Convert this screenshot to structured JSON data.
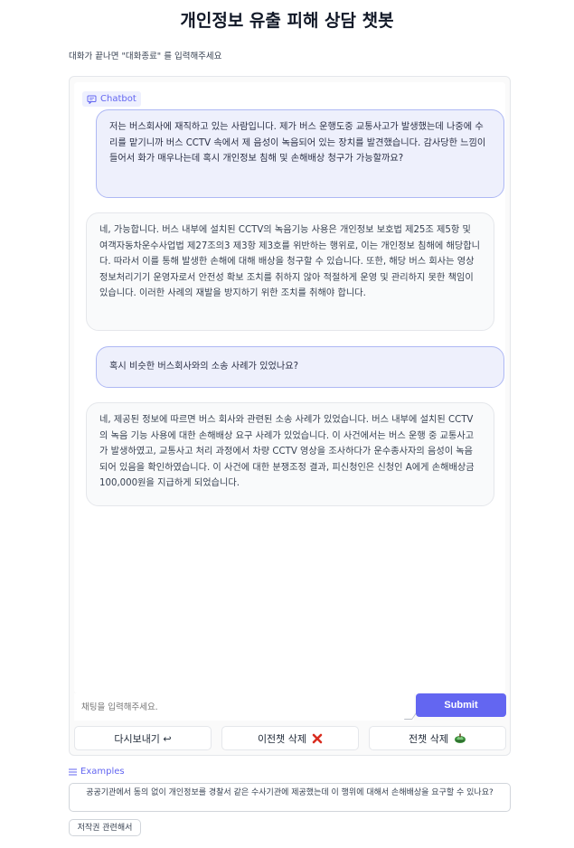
{
  "page": {
    "title": "개인정보 유출 피해 상담 챗봇",
    "description": "대화가 끝나면 \"대화종료\" 를 입력해주세요"
  },
  "chatbot": {
    "label": "Chatbot",
    "messages": [
      {
        "role": "user",
        "text": "저는 버스회사에 재직하고 있는 사람입니다. 제가 버스 운행도중 교통사고가 발생했는데 나중에 수리를 맡기니까 버스 CCTV 속에서 제 음성이 녹음되어 있는 장치를 발견했습니다. 감사당한 느낌이 들어서 화가 매우나는데 혹시 개인정보 침해 및 손해배상 청구가 가능할까요?"
      },
      {
        "role": "bot",
        "text": "네, 가능합니다. 버스 내부에 설치된 CCTV의 녹음기능 사용은 개인정보 보호법 제25조 제5항 및 여객자동차운수사업법 제27조의3 제3항 제3호를 위반하는 행위로, 이는 개인정보 침해에 해당합니다. 따라서 이를 통해 발생한 손해에 대해 배상을 청구할 수 있습니다. 또한, 해당 버스 회사는 영상정보처리기기 운영자로서 안전성 확보 조치를 취하지 않아 적절하게 운영 및 관리하지 못한 책임이 있습니다. 이러한 사례의 재발을 방지하기 위한 조치를 취해야 합니다."
      },
      {
        "role": "user",
        "text": "혹시 비슷한 버스회사와의 소송 사례가 있었나요?"
      },
      {
        "role": "bot",
        "text": "네, 제공된 정보에 따르면 버스 회사와 관련된 소송 사례가 있었습니다. 버스 내부에 설치된 CCTV의 녹음 기능 사용에 대한 손해배상 요구 사례가 있었습니다. 이 사건에서는 버스 운행 중 교통사고가 발생하였고, 교통사고 처리 과정에서 차량 CCTV 영상을 조사하다가 운수종사자의 음성이 녹음되어 있음을 확인하였습니다. 이 사건에 대한 분쟁조정 결과, 피신청인은 신청인 A에게 손해배상금 100,000원을 지급하게 되었습니다."
      }
    ]
  },
  "input": {
    "placeholder": "채팅을 입력해주세요.",
    "submit_label": "Submit"
  },
  "actions": {
    "retry_label": "다시보내기 ↩",
    "undo_label": "이전챗 삭제",
    "clear_label": "전챗 삭제"
  },
  "examples": {
    "label": "Examples",
    "items": [
      "공공기관에서 동의 없이 개인정보를 경찰서 같은 수사기관에 제공했는데 이 행위에 대해서 손해배상을 요구할 수 있나요?",
      "저작권 관련해서"
    ]
  },
  "colors": {
    "accent": "#6366f1",
    "user_bubble": "#eef0fc",
    "user_border": "#aeb8f4",
    "bot_bubble": "#f9fafb"
  },
  "icons": {
    "chatbot": "chat-bubble-icon",
    "undo": "red-x-icon",
    "clear": "broom-icon",
    "examples": "list-icon"
  }
}
